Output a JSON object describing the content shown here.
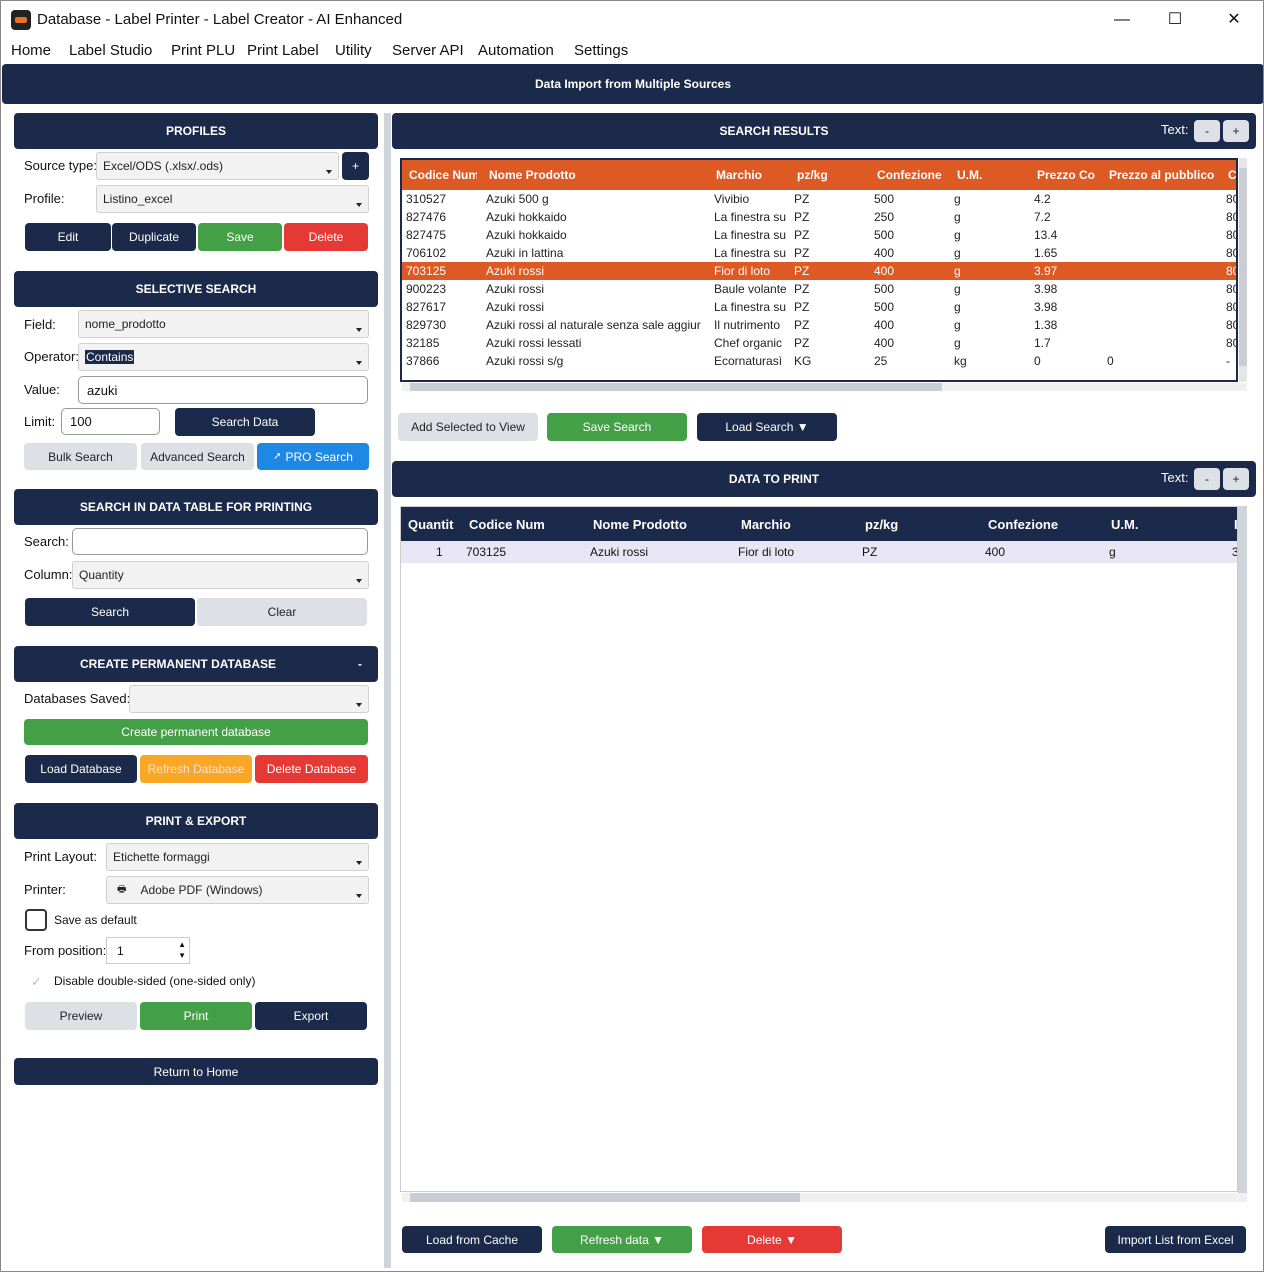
{
  "window": {
    "title": "Database - Label Printer - Label Creator - AI Enhanced",
    "minimize": "—",
    "maximize": "☐",
    "close": "✕"
  },
  "menu": [
    "Home",
    "Label Studio",
    "Print PLU",
    "Print Label",
    "Utility",
    "Server API",
    "Automation",
    "Settings"
  ],
  "banner": "Data Import from Multiple Sources",
  "profiles": {
    "header": "PROFILES",
    "source_type_label": "Source type:",
    "source_type_value": "Excel/ODS (.xlsx/.ods)",
    "add_label": "+",
    "profile_label": "Profile:",
    "profile_value": "Listino_excel",
    "edit": "Edit",
    "duplicate": "Duplicate",
    "save": "Save",
    "delete": "Delete"
  },
  "selective": {
    "header": "SELECTIVE SEARCH",
    "field_label": "Field:",
    "field_value": "nome_prodotto",
    "operator_label": "Operator:",
    "operator_value": "Contains",
    "value_label": "Value:",
    "value": "azuki",
    "limit_label": "Limit:",
    "limit_value": "100",
    "search_data": "Search Data",
    "bulk": "Bulk Search",
    "advanced": "Advanced Search",
    "pro": "PRO Search"
  },
  "table_search": {
    "header": "SEARCH IN DATA TABLE FOR PRINTING",
    "search_label": "Search:",
    "search_value": "",
    "column_label": "Column:",
    "column_value": "Quantity",
    "search_btn": "Search",
    "clear_btn": "Clear"
  },
  "permanent": {
    "header": "CREATE PERMANENT DATABASE",
    "collapse": "-",
    "saved_label": "Databases Saved:",
    "saved_value": "",
    "create": "Create permanent database",
    "load": "Load Database",
    "refresh": "Refresh Database",
    "delete": "Delete Database"
  },
  "print_export": {
    "header": "PRINT & EXPORT",
    "layout_label": "Print Layout:",
    "layout_value": "Etichette formaggi",
    "printer_label": "Printer:",
    "printer_value": "Adobe PDF (Windows)",
    "save_default": "Save as default",
    "from_label": "From position:",
    "from_value": "1",
    "disable_double": "Disable double-sided (one-sided only)",
    "preview": "Preview",
    "print": "Print",
    "export": "Export"
  },
  "return_home": "Return to Home",
  "search_results": {
    "header": "SEARCH RESULTS",
    "text_label": "Text:",
    "minus": "-",
    "plus": "+",
    "columns": [
      "Codice Num",
      "Nome Prodotto",
      "Marchio",
      "pz/kg",
      "Confezione",
      "U.M.",
      "Prezzo Co",
      "Prezzo al pubblico",
      "C"
    ],
    "rows": [
      [
        "310527",
        "Azuki 500 g",
        "Vivibio",
        "PZ",
        "500",
        "g",
        "4.2",
        "",
        "80"
      ],
      [
        "827476",
        "Azuki hokkaido",
        "La finestra su",
        "PZ",
        "250",
        "g",
        "7.2",
        "",
        "80"
      ],
      [
        "827475",
        "Azuki hokkaido",
        "La finestra su",
        "PZ",
        "500",
        "g",
        "13.4",
        "",
        "80"
      ],
      [
        "706102",
        "Azuki in lattina",
        "La finestra su",
        "PZ",
        "400",
        "g",
        "1.65",
        "",
        "80"
      ],
      [
        "703125",
        "Azuki rossi",
        "Fior di loto",
        "PZ",
        "400",
        "g",
        "3.97",
        "",
        "80"
      ],
      [
        "900223",
        "Azuki rossi",
        "Baule volante",
        "PZ",
        "500",
        "g",
        "3.98",
        "",
        "80"
      ],
      [
        "827617",
        "Azuki rossi",
        "La finestra su",
        "PZ",
        "500",
        "g",
        "3.98",
        "",
        "80"
      ],
      [
        "829730",
        "Azuki rossi al naturale senza sale aggiur",
        "Il nutrimento",
        "PZ",
        "400",
        "g",
        "1.38",
        "",
        "80"
      ],
      [
        "32185",
        "Azuki rossi lessati",
        "Chef organic",
        "PZ",
        "400",
        "g",
        "1.7",
        "",
        "80"
      ],
      [
        "37866",
        "Azuki rossi s/g",
        "Ecornaturasì",
        "KG",
        "25",
        "kg",
        "0",
        "0",
        "-"
      ]
    ],
    "selected_row": 4,
    "add_selected": "Add Selected to View",
    "save_search": "Save Search",
    "load_search": "Load Search ▼"
  },
  "data_to_print": {
    "header": "DATA TO PRINT",
    "text_label": "Text:",
    "minus": "-",
    "plus": "+",
    "columns": [
      "Quantit",
      "Codice Num",
      "Nome Prodotto",
      "Marchio",
      "pz/kg",
      "Confezione",
      "U.M.",
      "I"
    ],
    "rows": [
      [
        "1",
        "703125",
        "Azuki rossi",
        "Fior di loto",
        "PZ",
        "400",
        "g",
        "3"
      ]
    ],
    "load_cache": "Load from Cache",
    "refresh": "Refresh data ▼",
    "delete": "Delete ▼",
    "import_excel": "Import List from Excel"
  }
}
